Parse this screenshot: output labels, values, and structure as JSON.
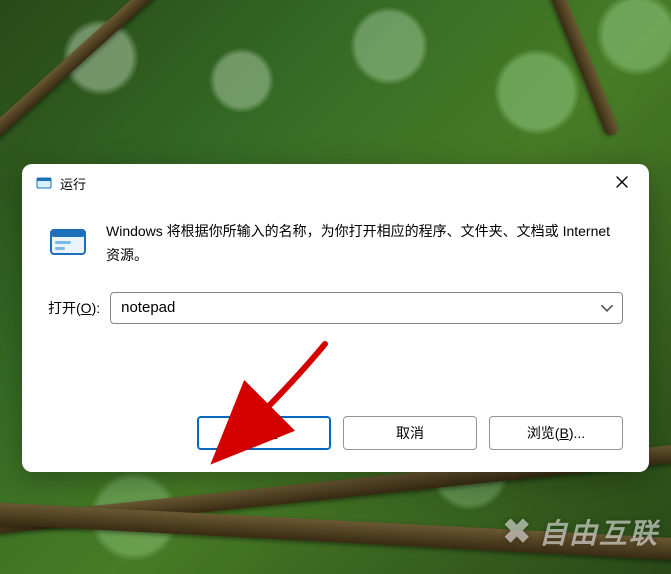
{
  "window": {
    "title": "运行",
    "description": "Windows 将根据你所输入的名称，为你打开相应的程序、文件夹、文档或 Internet 资源。"
  },
  "open": {
    "label_prefix": "打开(",
    "label_key": "O",
    "label_suffix": "):",
    "value": "notepad"
  },
  "buttons": {
    "ok": "确定",
    "cancel": "取消",
    "browse_prefix": "浏览(",
    "browse_key": "B",
    "browse_suffix": ")..."
  },
  "watermark": "自由互联",
  "colors": {
    "accent": "#0067c0",
    "arrow": "#d40000"
  }
}
